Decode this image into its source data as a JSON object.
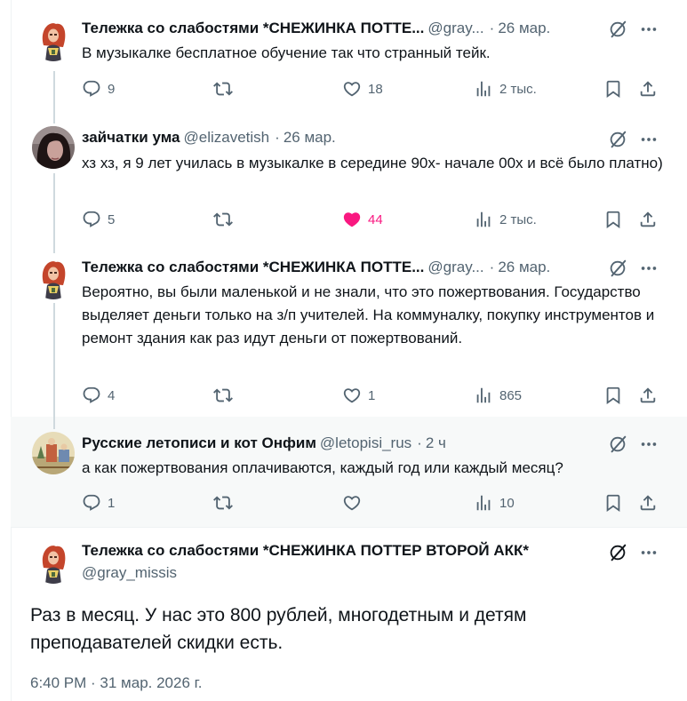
{
  "tweets": [
    {
      "name": "Тележка со слабостями *СНЕЖИНКА ПОТТЕ...",
      "handle": "@gray...",
      "time": "26 мар.",
      "text": "В музыкалке бесплатное обучение так что странный тейк.",
      "replies": "9",
      "reposts": "",
      "likes": "18",
      "views": "2 тыс.",
      "liked": false
    },
    {
      "name": "зайчатки ума",
      "handle": "@elizavetish",
      "time": "26 мар.",
      "text": "хз хз, я 9 лет училась в музыкалке в середине 90х- начале 00х и всё было платно)",
      "replies": "5",
      "reposts": "",
      "likes": "44",
      "views": "2 тыс.",
      "liked": true
    },
    {
      "name": "Тележка со слабостями *СНЕЖИНКА ПОТТЕ...",
      "handle": "@gray...",
      "time": "26 мар.",
      "text": "Вероятно, вы были маленькой и не знали, что это пожертвования. Государство выделяет деньги только на з/п учителей. На коммуналку, покупку инструментов и ремонт здания как раз идут деньги от пожертвований.",
      "replies": "4",
      "reposts": "",
      "likes": "1",
      "views": "865",
      "liked": false
    },
    {
      "name": "Русские летописи и кот Онфим",
      "handle": "@letopisi_rus",
      "time": "2 ч",
      "text": "а как пожертвования оплачиваются, каждый год или каждый месяц?",
      "replies": "1",
      "reposts": "",
      "likes": "",
      "views": "10",
      "liked": false
    }
  ],
  "main_tweet": {
    "name": "Тележка со слабостями *СНЕЖИНКА ПОТТЕР ВТОРОЙ АКК*",
    "handle": "@gray_missis",
    "text": "Раз в месяц. У нас это 800 рублей, многодетным и детям преподавателей скидки есть.",
    "timestamp": "6:40 PM · 31 мар. 2026 г."
  },
  "colors": {
    "text": "#0f1419",
    "secondary": "#536471",
    "like": "#f91880",
    "thread_line": "#cfd9de",
    "highlight_bg": "#f7f9f9"
  },
  "icons": [
    "reply-icon",
    "repost-icon",
    "like-icon",
    "views-icon",
    "bookmark-icon",
    "share-icon",
    "grok-icon",
    "more-icon"
  ]
}
